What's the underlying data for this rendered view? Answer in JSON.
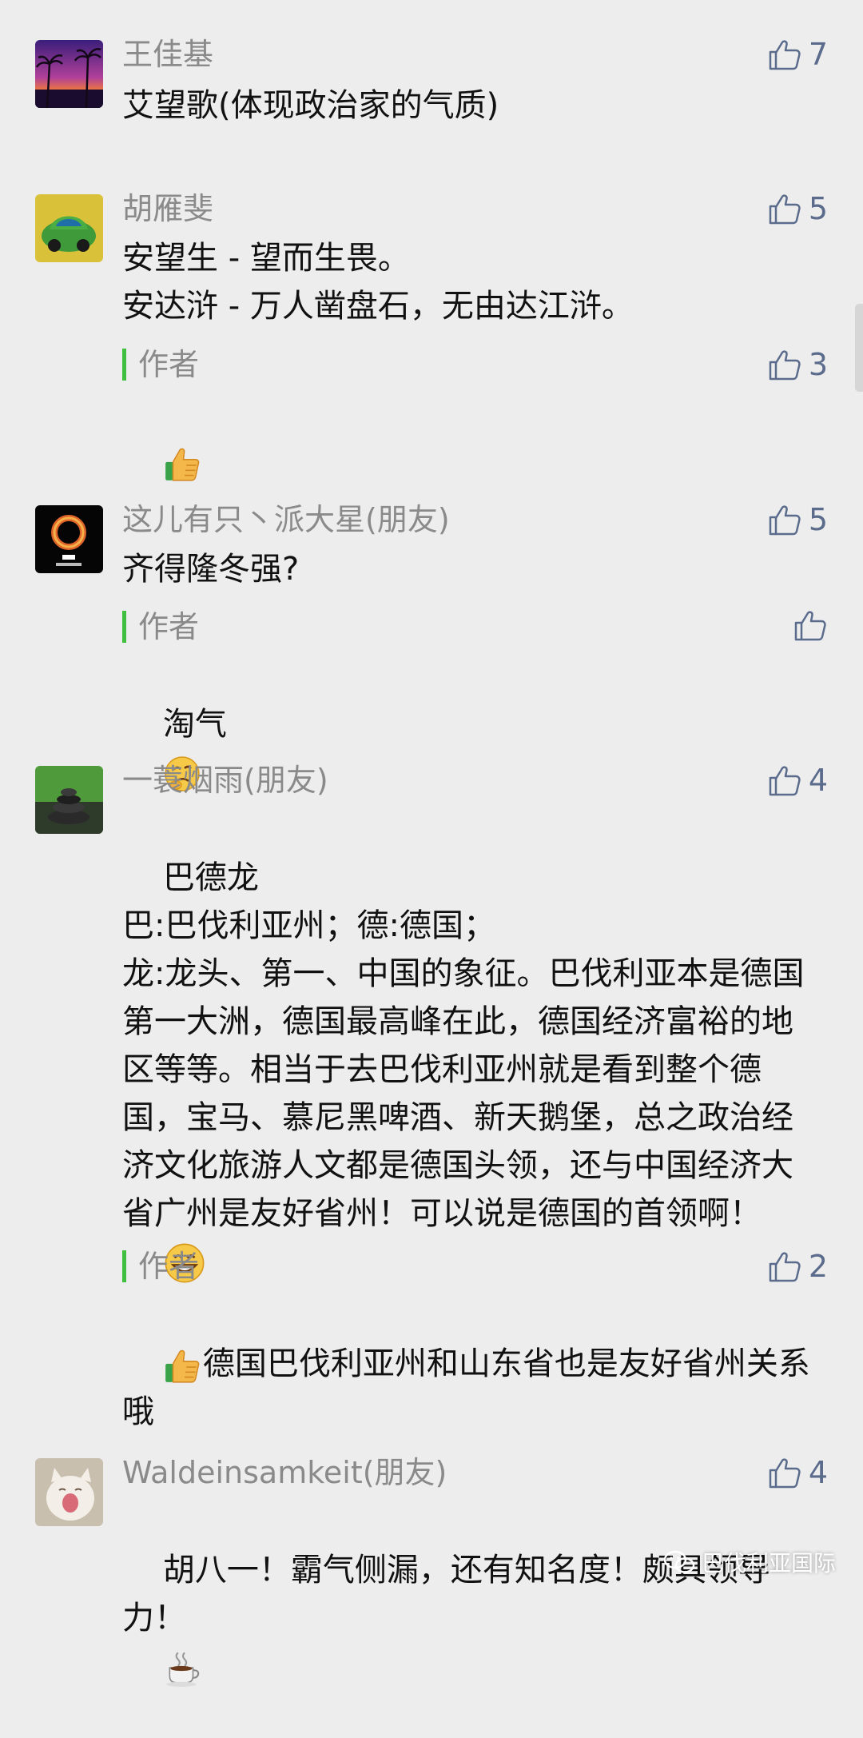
{
  "comments": [
    {
      "name": "王佳基",
      "likes": "7",
      "text": "艾望歌(体现政治家的气质)"
    },
    {
      "name": "胡雁斐",
      "likes": "5",
      "text": "安望生 - 望而生畏。\n安达浒 - 万人凿盘石，无由达江浒。",
      "reply": {
        "label": "作者",
        "likes": "3",
        "emoji": "thumbs-up-emoji"
      }
    },
    {
      "name": "这儿有只丶派大星(朋友)",
      "likes": "5",
      "text": "齐得隆冬强?",
      "reply": {
        "label": "作者",
        "likes": "",
        "text": "淘气"
      }
    },
    {
      "name": "一蓑烟雨(朋友)",
      "likes": "4",
      "text": "巴德龙\n巴:巴伐利亚州；德:德国；\n龙:龙头、第一、中国的象征。巴伐利亚本是德国第一大洲，德国最高峰在此，德国经济富裕的地区等等。相当于去巴伐利亚州就是看到整个德国，宝马、慕尼黑啤酒、新天鹅堡，总之政治经济文化旅游人文都是德国头领，还与中国经济大省广州是友好省州！可以说是德国的首领啊！",
      "reply": {
        "label": "作者",
        "likes": "2",
        "text": "德国巴伐利亚州和山东省也是友好省州关系哦"
      }
    },
    {
      "name": "Waldeinsamkeit(朋友)",
      "likes": "4",
      "text": "胡八一！霸气侧漏，还有知名度！颇具领导力！"
    }
  ],
  "watermark": {
    "text": "巴伐利亚国际"
  },
  "colors": {
    "background": "#ededed",
    "name": "#8a8a8a",
    "like": "#5b6b8c",
    "reply_bar": "#3fbf3f"
  }
}
